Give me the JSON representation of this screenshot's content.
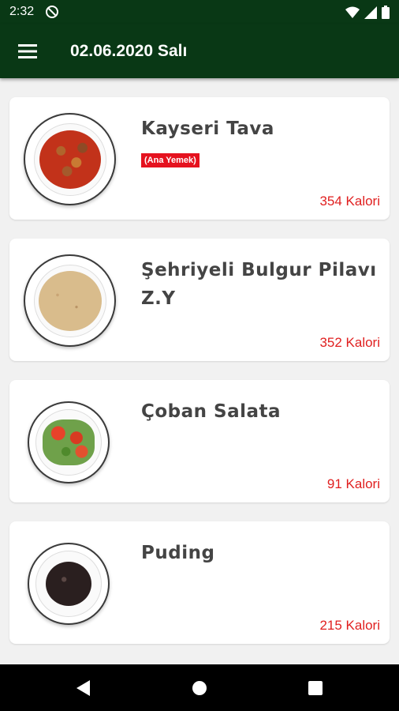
{
  "status_bar": {
    "time": "2:32",
    "icons": [
      "do-not-disturb-icon",
      "wifi-icon",
      "signal-icon",
      "battery-icon"
    ]
  },
  "app_bar": {
    "title": "02.06.2020 Salı",
    "menu_icon": "hamburger-menu-icon",
    "background": "#093815"
  },
  "colors": {
    "accent": "#093815",
    "calorie": "#e01f1f",
    "badge": "#e5121f"
  },
  "menu_items": [
    {
      "name": "Kayseri Tava",
      "category": "(Ana Yemek)",
      "calories": "354 Kalori",
      "image": "stew-plate"
    },
    {
      "name": "Şehriyeli Bulgur Pilavı Z.Y",
      "category": "",
      "calories": "352 Kalori",
      "image": "bulgur-plate"
    },
    {
      "name": "Çoban Salata",
      "category": "",
      "calories": "91 Kalori",
      "image": "salad-plate"
    },
    {
      "name": "Puding",
      "category": "",
      "calories": "215 Kalori",
      "image": "pudding-plate"
    }
  ],
  "nav_bar": {
    "icons": [
      "back-icon",
      "home-icon",
      "recents-icon"
    ]
  }
}
